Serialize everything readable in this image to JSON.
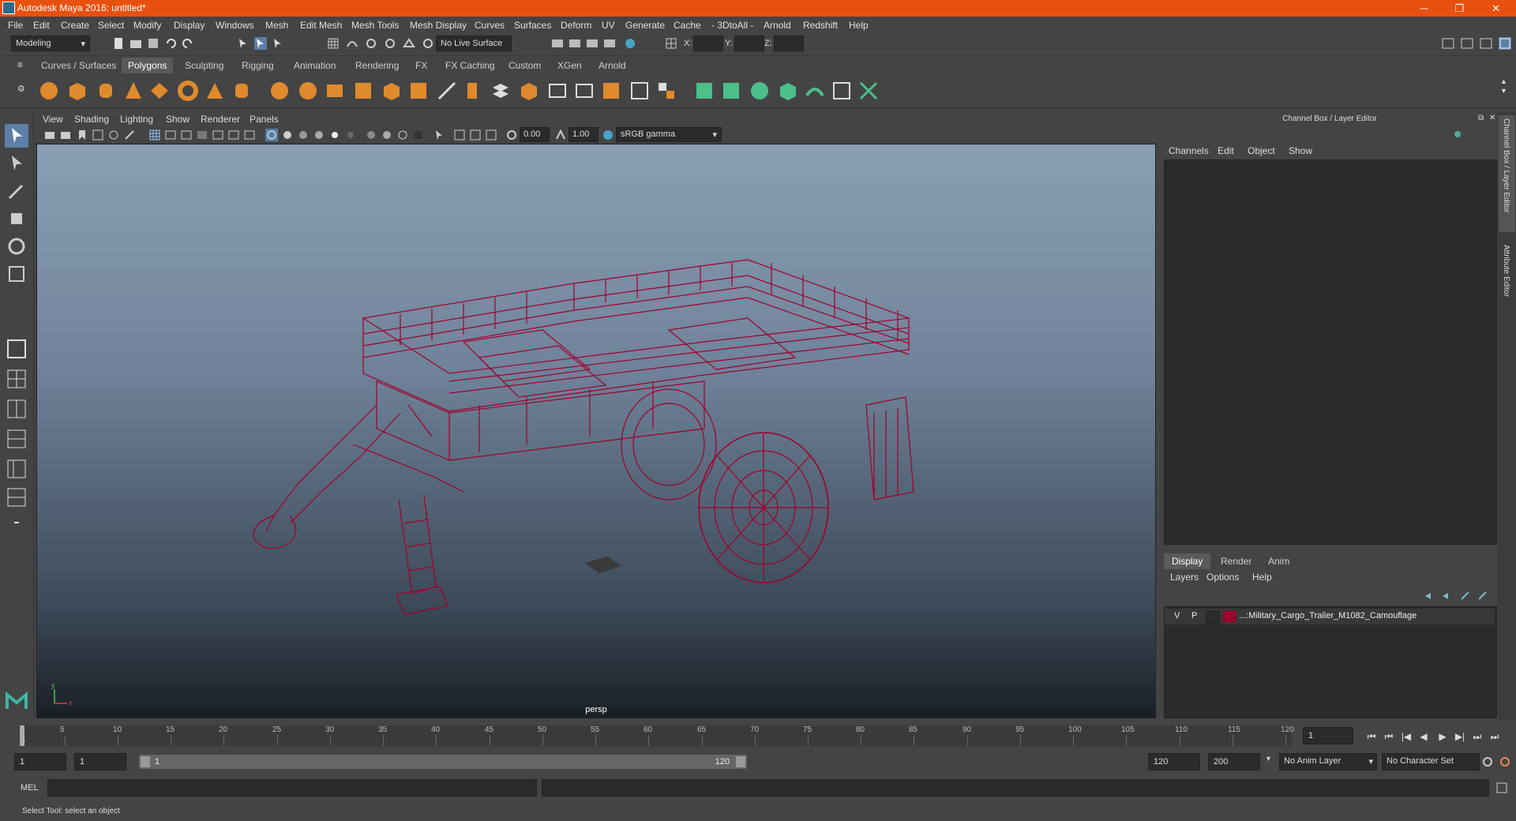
{
  "titlebar": {
    "title": "Autodesk Maya 2016: untitled*",
    "minimize": "─",
    "maximize": "❐",
    "close": "✕"
  },
  "menubar": {
    "items": [
      "File",
      "Edit",
      "Create",
      "Select",
      "Modify",
      "Display",
      "Windows",
      "Mesh",
      "Edit Mesh",
      "Mesh Tools",
      "Mesh Display",
      "Curves",
      "Surfaces",
      "Deform",
      "UV",
      "Generate",
      "Cache",
      "- 3DtoAll -",
      "Arnold",
      "Redshift",
      "Help"
    ]
  },
  "statusline": {
    "mode": "Modeling",
    "live_surface": "No Live Surface",
    "x_label": "X:",
    "y_label": "Y:",
    "z_label": "Z:"
  },
  "shelf": {
    "tabs": [
      "Curves / Surfaces",
      "Polygons",
      "Sculpting",
      "Rigging",
      "Animation",
      "Rendering",
      "FX",
      "FX Caching",
      "Custom",
      "XGen",
      "Arnold"
    ],
    "active_tab": "Polygons"
  },
  "viewport": {
    "menu": [
      "View",
      "Shading",
      "Lighting",
      "Show",
      "Renderer",
      "Panels"
    ],
    "near_value": "0.00",
    "far_value": "1.00",
    "color_space": "sRGB gamma",
    "camera_label": "persp",
    "axis_y": "y",
    "axis_x": "x",
    "wire_color": "#a0002c"
  },
  "right_panel": {
    "title": "Channel Box / Layer Editor",
    "menu": [
      "Channels",
      "Edit",
      "Object",
      "Show"
    ],
    "tabs": [
      "Display",
      "Render",
      "Anim"
    ],
    "active_tab": "Display",
    "layer_menu": [
      "Layers",
      "Options",
      "Help"
    ],
    "layer": {
      "v": "V",
      "p": "P",
      "name": "...:Military_Cargo_Trailer_M1082_Camouflage",
      "color": "#a0002c"
    }
  },
  "side_tabs": {
    "channel_box": "Channel Box / Layer Editor",
    "attribute_editor": "Attribute Editor"
  },
  "timeline": {
    "ticks": [
      "5",
      "10",
      "15",
      "20",
      "25",
      "30",
      "35",
      "40",
      "45",
      "50",
      "55",
      "60",
      "65",
      "70",
      "75",
      "80",
      "85",
      "90",
      "95",
      "100",
      "105",
      "110",
      "115",
      "120"
    ],
    "start_tick": "1",
    "current_frame": "1"
  },
  "range": {
    "start": "1",
    "playback_start": "1",
    "slider_start": "1",
    "slider_end": "120",
    "playback_end": "120",
    "end": "200",
    "anim_layer": "No Anim Layer",
    "char_set": "No Character Set"
  },
  "cmdline": {
    "label": "MEL"
  },
  "helpline": {
    "text": "Select Tool: select an object"
  }
}
